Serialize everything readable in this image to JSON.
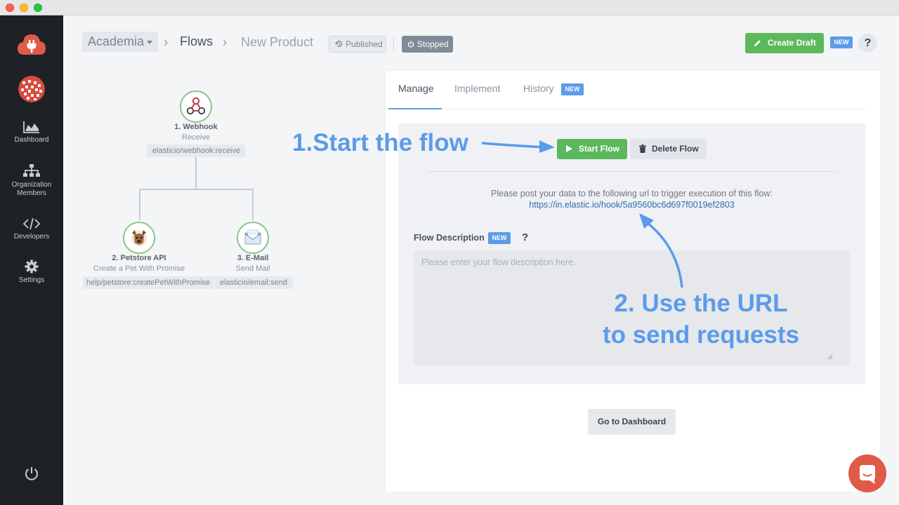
{
  "header": {
    "org": "Academia",
    "flows": "Flows",
    "flow_name": "New Product",
    "published": "Published",
    "stopped": "Stopped",
    "create_draft": "Create Draft",
    "new_badge": "NEW",
    "help": "?"
  },
  "sidebar": {
    "items": [
      {
        "label": "Dashboard"
      },
      {
        "label": "Organization Members"
      },
      {
        "label": "Developers"
      },
      {
        "label": "Settings"
      }
    ]
  },
  "graph": {
    "nodes": [
      {
        "title": "1. Webhook",
        "subtitle": "Receive",
        "tag": "elasticio/webhook:receive"
      },
      {
        "title": "2. Petstore API",
        "subtitle": "Create a Pet With Promise",
        "tag": "help/petstore:createPetWithPromise"
      },
      {
        "title": "3. E-Mail",
        "subtitle": "Send Mail",
        "tag": "elasticio/email:send"
      }
    ]
  },
  "tabs": [
    {
      "label": "Manage"
    },
    {
      "label": "Implement"
    },
    {
      "label": "History"
    }
  ],
  "tab_new": "NEW",
  "manage": {
    "start_flow": "Start Flow",
    "delete_flow": "Delete Flow",
    "post_text": "Please post your data to the following url to trigger execution of this flow:",
    "hook_url": "https://in.elastic.io/hook/5a9560bc6d697f0019ef2803",
    "description_label": "Flow Description",
    "description_new": "NEW",
    "description_help": "?",
    "description_placeholder": "Please enter your flow description here.",
    "go_dashboard": "Go to Dashboard"
  },
  "annotations": {
    "step1": "1.Start the flow",
    "step2_line1": "2. Use the URL",
    "step2_line2": "to send requests"
  },
  "colors": {
    "accent_blue": "#5b9bea",
    "green": "#5cb85c",
    "sidebar": "#1e2126",
    "logo_red": "#e05b47"
  }
}
